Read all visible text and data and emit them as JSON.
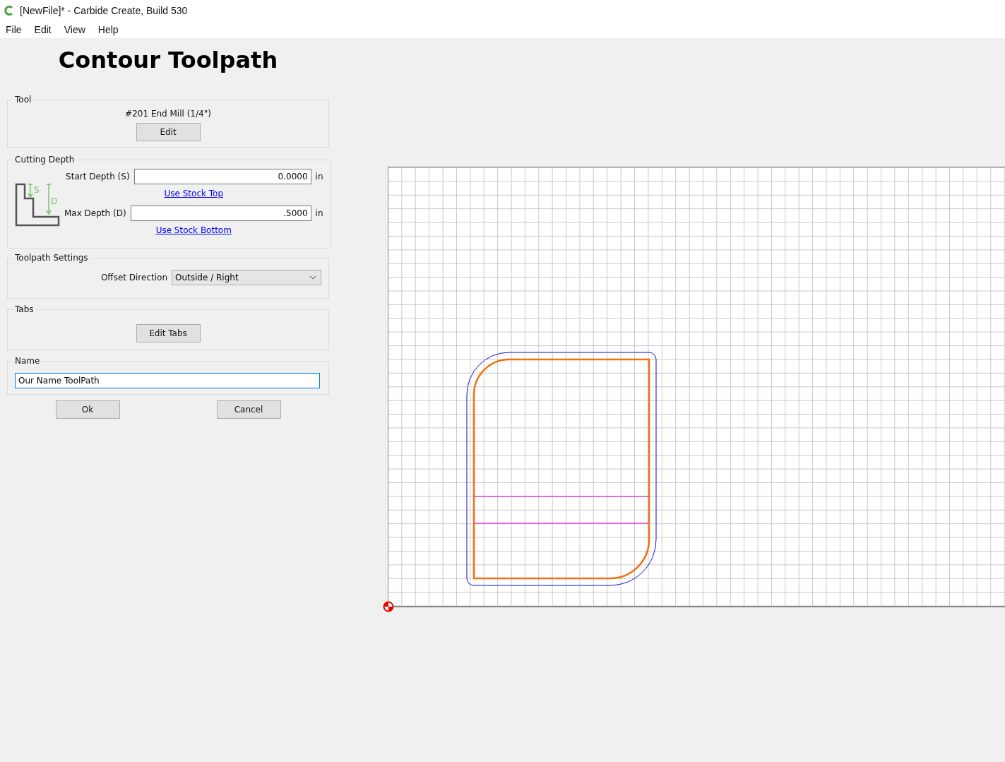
{
  "window": {
    "title": "[NewFile]* - Carbide Create, Build 530"
  },
  "menu": [
    "File",
    "Edit",
    "View",
    "Help"
  ],
  "panel": {
    "heading": "Contour Toolpath",
    "tool": {
      "legend": "Tool",
      "name": "#201 End Mill (1/4\")",
      "button": "Edit"
    },
    "cutting_depth": {
      "legend": "Cutting Depth",
      "icon_letters": [
        "S",
        "D"
      ],
      "fields": [
        {
          "label": "Start Depth (S)",
          "value": "0.0000",
          "unit": "in",
          "link": "Use Stock Top"
        },
        {
          "label": "Max Depth (D)",
          "value": ".5000",
          "unit": "in",
          "link": "Use Stock Bottom"
        }
      ]
    },
    "toolpath_settings": {
      "legend": "Toolpath Settings",
      "label": "Offset Direction",
      "value": "Outside / Right"
    },
    "tabs": {
      "legend": "Tabs",
      "button": "Edit Tabs"
    },
    "name": {
      "legend": "Name",
      "value": "Our Name ToolPath",
      "focused": true
    },
    "buttons": [
      "Ok",
      "Cancel"
    ]
  }
}
